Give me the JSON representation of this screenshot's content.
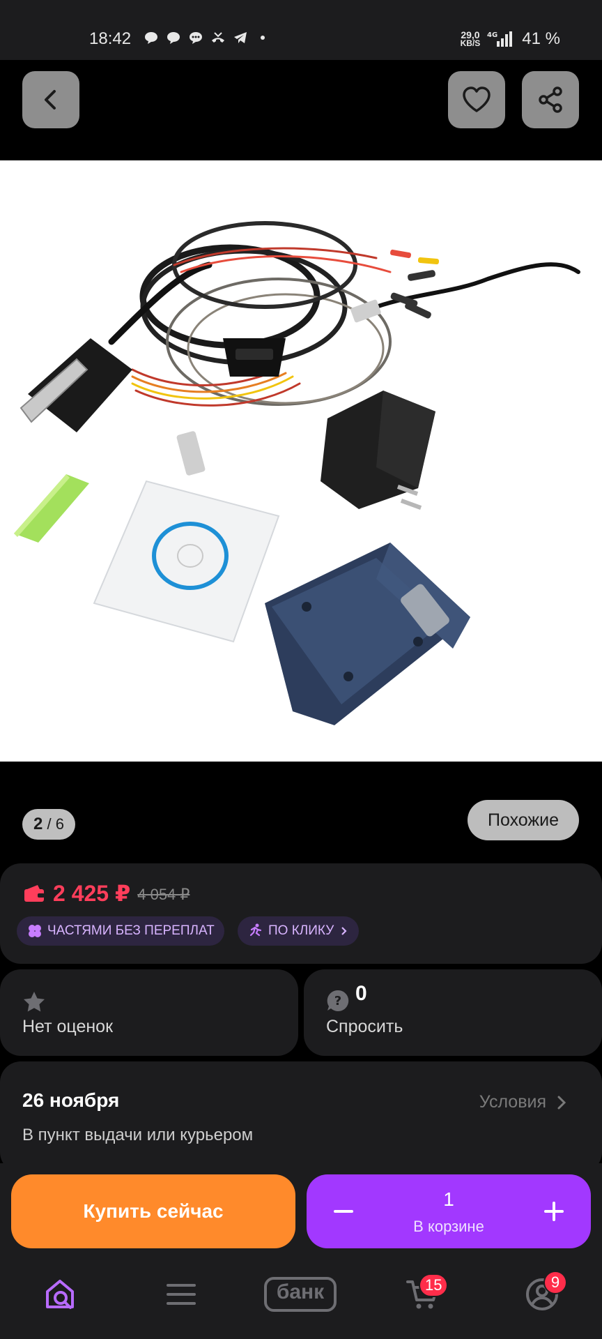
{
  "status_bar": {
    "time": "18:42",
    "net_speed_value": "29,0",
    "net_speed_unit": "KB/S",
    "battery": "41 %"
  },
  "product": {
    "image_position": "2",
    "image_total": "/ 6",
    "similar_label": "Похожие",
    "price": "2 425 ₽",
    "old_price": "4 054 ₽",
    "badge_parts": "ЧАСТЯМИ БЕЗ ПЕРЕПЛАТ",
    "badge_click": "ПО КЛИКУ",
    "rating_label": "Нет оценок",
    "questions_count": "0",
    "ask_label": "Спросить"
  },
  "delivery": {
    "date": "26 ноября",
    "description": "В пункт выдачи или курьером",
    "conditions_label": "Условия"
  },
  "actions": {
    "buy_now": "Купить сейчас",
    "cart_quantity": "1",
    "cart_label": "В корзине"
  },
  "bottom_nav": {
    "bank_label": "банк",
    "cart_badge": "15",
    "profile_badge": "9"
  },
  "colors": {
    "accent_purple": "#a238ff",
    "buy_orange": "#ff8a2b",
    "price_red": "#ff3e5b"
  }
}
